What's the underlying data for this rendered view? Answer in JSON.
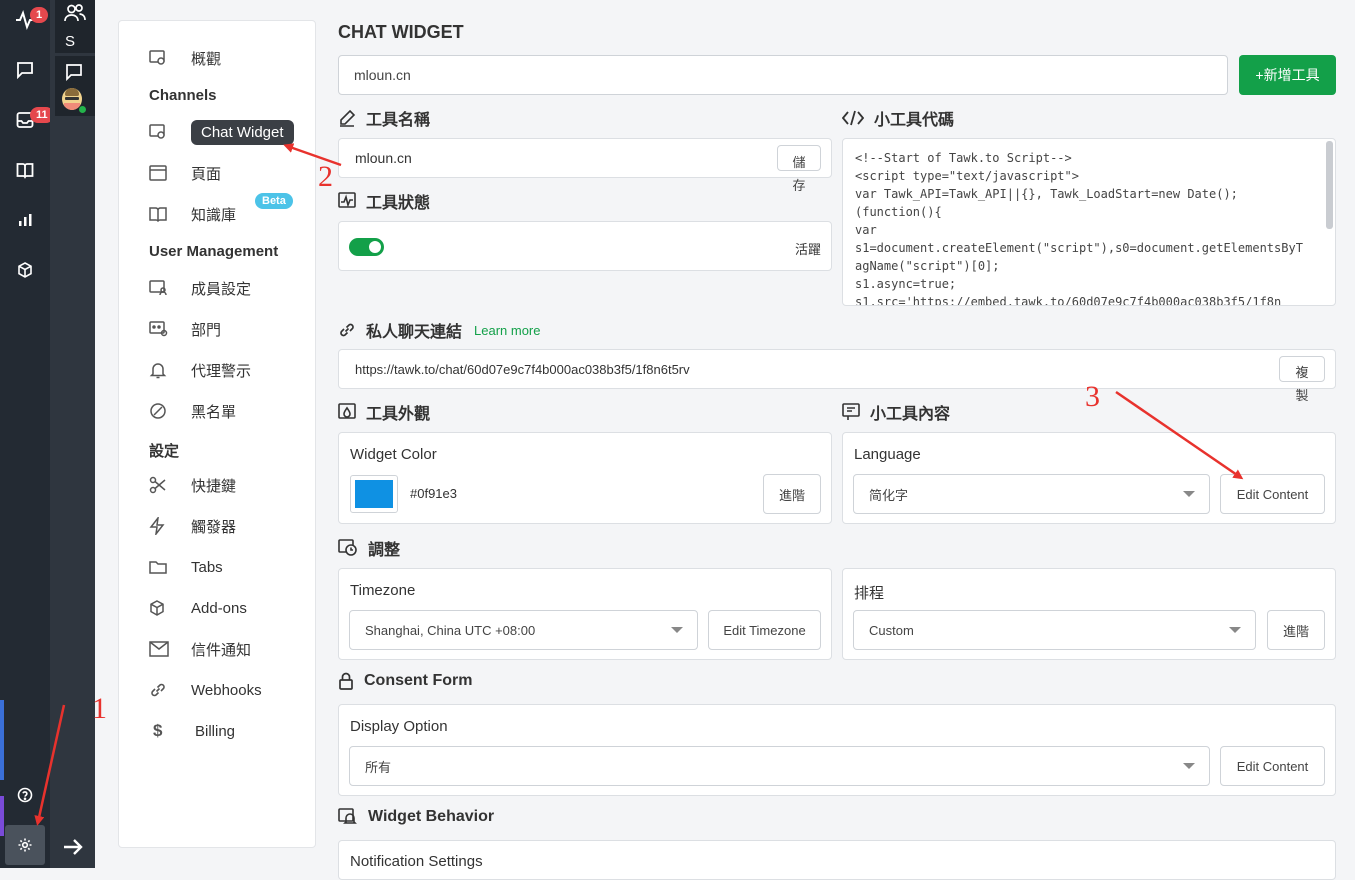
{
  "rail": {
    "activity_badge": "1",
    "inbox_badge": "11",
    "user_initial": "S"
  },
  "nav": {
    "overview": "概觀",
    "channels_heading": "Channels",
    "chat_widget": "Chat Widget",
    "pages": "頁面",
    "knowledge_base": "知識庫",
    "beta": "Beta",
    "user_mgmt_heading": "User Management",
    "members": "成員設定",
    "departments": "部門",
    "agent_alerts": "代理警示",
    "blacklist": "黑名單",
    "settings_heading": "設定",
    "shortcuts": "快捷鍵",
    "triggers": "觸發器",
    "tabs": "Tabs",
    "addons": "Add-ons",
    "email_notify": "信件通知",
    "webhooks": "Webhooks",
    "billing": "Billing"
  },
  "main": {
    "title": "CHAT WIDGET",
    "property_select": "mloun.cn",
    "add_widget_button": "+新增工具",
    "widget_name_label": "工具名稱",
    "widget_name_value": "mloun.cn",
    "save_button": "儲存",
    "widget_status_label": "工具狀態",
    "status_value": "活躍",
    "widget_code_label": "小工具代碼",
    "widget_code": "<!--Start of Tawk.to Script-->\n<script type=\"text/javascript\">\nvar Tawk_API=Tawk_API||{}, Tawk_LoadStart=new Date();\n(function(){\nvar\ns1=document.createElement(\"script\"),s0=document.getElementsByTagName(\"script\")[0];\ns1.async=true;\ns1.src='https://embed.tawk.to/60d07e9c7f4b000ac038b3f5/1f8n",
    "direct_link_label": "私人聊天連結",
    "learn_more": "Learn more",
    "direct_link_value": "https://tawk.to/chat/60d07e9c7f4b000ac038b3f5/1f8n6t5rv",
    "copy_button": "複製",
    "appearance_label": "工具外觀",
    "widget_color_label": "Widget Color",
    "widget_color_hex": "#0f91e3",
    "advanced_button": "進階",
    "content_label": "小工具內容",
    "language_label": "Language",
    "language_value": "简化字",
    "edit_content_button": "Edit Content",
    "adjust_label": "調整",
    "timezone_label": "Timezone",
    "timezone_value": "Shanghai, China UTC +08:00",
    "edit_timezone_button": "Edit Timezone",
    "schedule_label": "排程",
    "schedule_value": "Custom",
    "advanced_button2": "進階",
    "consent_label": "Consent Form",
    "display_option_label": "Display Option",
    "display_option_value": "所有",
    "edit_content_button2": "Edit Content",
    "behavior_label": "Widget Behavior",
    "notification_settings_label": "Notification Settings"
  },
  "annotations": {
    "n1": "1",
    "n2": "2",
    "n3": "3"
  },
  "colors": {
    "accent_green": "#13a049",
    "swatch": "#0f91e3",
    "annotation_red": "#e8322d"
  }
}
